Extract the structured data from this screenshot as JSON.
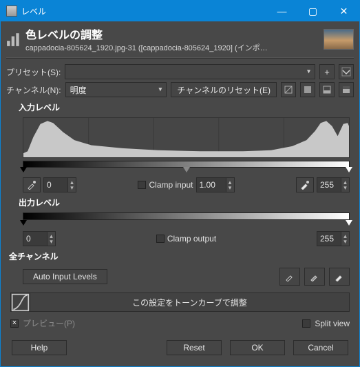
{
  "window": {
    "title": "レベル"
  },
  "header": {
    "title": "色レベルの調整",
    "subtitle": "cappadocia-805624_1920.jpg-31 ([cappadocia-805624_1920] (インポートされた..."
  },
  "preset": {
    "label": "プリセット(S):",
    "value": ""
  },
  "channel": {
    "label": "チャンネル(N):",
    "value": "明度",
    "reset": "チャンネルのリセット(E)"
  },
  "input_levels": {
    "label": "入力レベル",
    "low": "0",
    "gamma": "1.00",
    "high": "255",
    "clamp_label": "Clamp input"
  },
  "output_levels": {
    "label": "出力レベル",
    "low": "0",
    "high": "255",
    "clamp_label": "Clamp output"
  },
  "all_channels": {
    "label": "全チャンネル",
    "auto": "Auto Input Levels"
  },
  "tone_curve": {
    "label": "この設定をトーンカーブで調整"
  },
  "preview": {
    "label": "プレビュー(P)",
    "split": "Split view"
  },
  "footer": {
    "help": "Help",
    "reset": "Reset",
    "ok": "OK",
    "cancel": "Cancel"
  }
}
